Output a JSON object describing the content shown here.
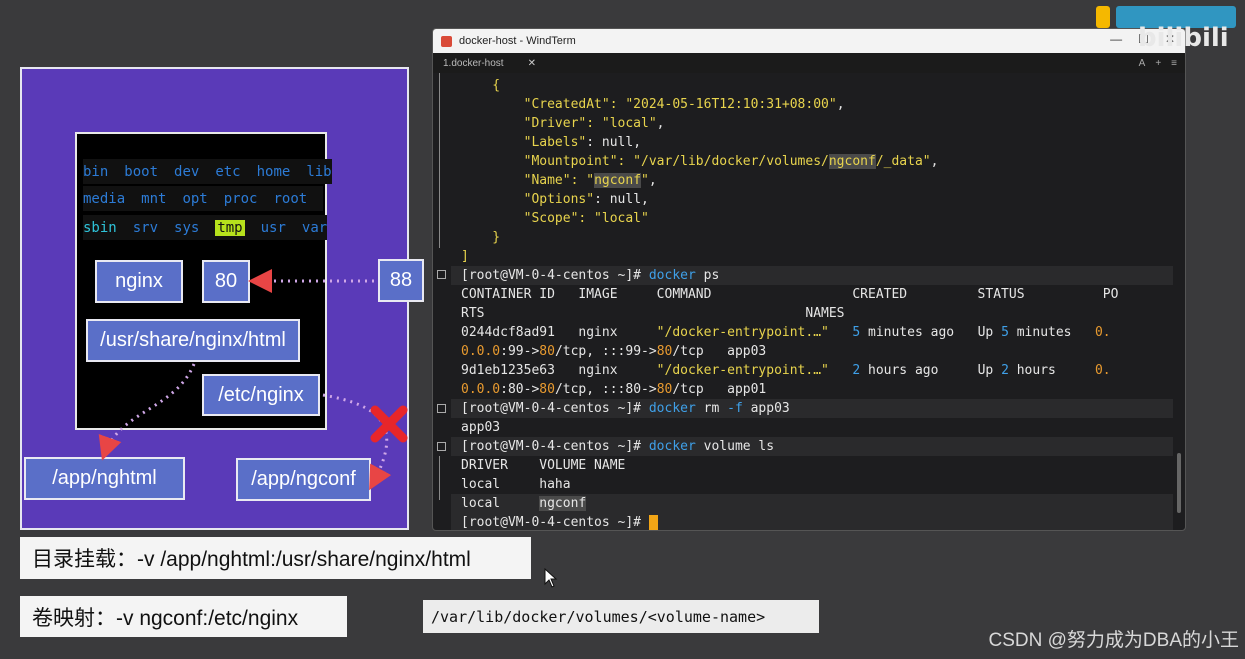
{
  "diagram": {
    "dir_rows": [
      [
        "bin",
        "boot",
        "dev",
        "etc",
        "home",
        "lib"
      ],
      [
        "media",
        "mnt",
        "opt",
        "proc",
        "root"
      ],
      [
        "sbin",
        "srv",
        "sys",
        "tmp",
        "usr",
        "var"
      ]
    ],
    "highlighted_dir": "tmp",
    "nginx_label": "nginx",
    "container_port": "80",
    "host_port": "88",
    "html_path": "/usr/share/nginx/html",
    "conf_path": "/etc/nginx",
    "host_html": "/app/nghtml",
    "host_conf": "/app/ngconf",
    "colors": {
      "panel": "#5a3ab8",
      "box": "#5a6fc8",
      "arrow": "#e84545",
      "cross": "#e8262a"
    }
  },
  "terminal": {
    "window_title": "docker-host - WindTerm",
    "tab_label": "1.docker-host",
    "tab_close": "✕",
    "tab_tools": [
      "A",
      "+",
      "≡"
    ],
    "window_controls": [
      "—",
      "☐",
      "✕"
    ]
  },
  "captions": {
    "bind_mount": "目录挂载：-v /app/nghtml:/usr/share/nginx/html",
    "volume_mount": "卷映射：-v ngconf:/etc/nginx",
    "volume_path": "/var/lib/docker/volumes/<volume-name>"
  },
  "watermark": "CSDN @努力成为DBA的小王",
  "logo_text": "bilibili"
}
